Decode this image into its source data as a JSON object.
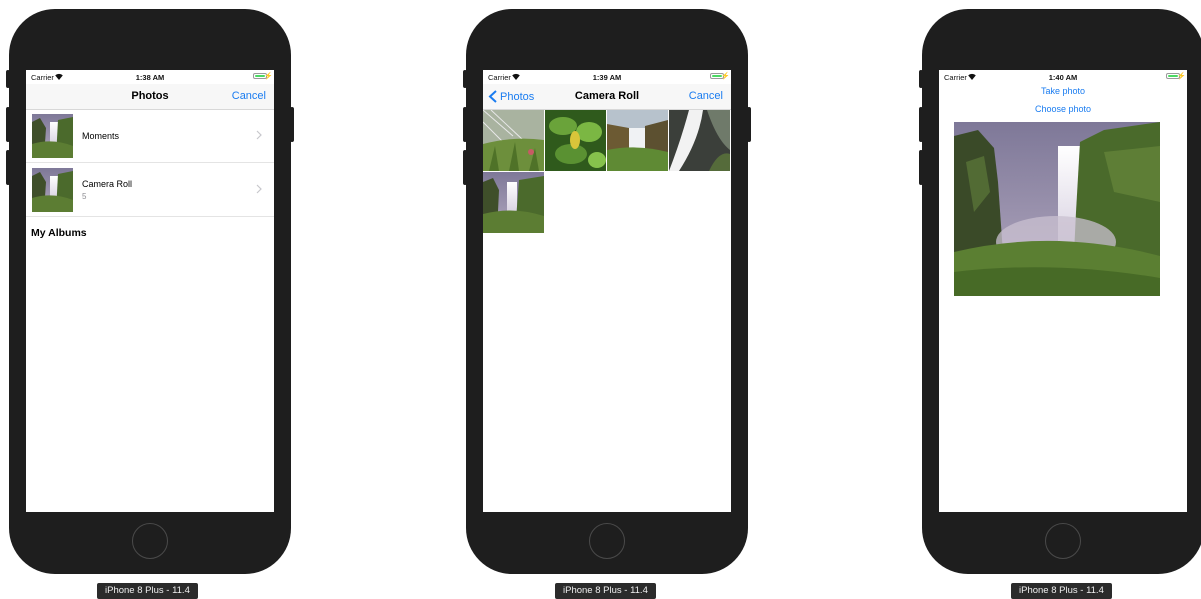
{
  "device_label": "iPhone 8 Plus - 11.4",
  "status": {
    "carrier": "Carrier",
    "times": [
      "1:38 AM",
      "1:39 AM",
      "1:40 AM"
    ]
  },
  "screen1": {
    "nav_title": "Photos",
    "cancel_label": "Cancel",
    "albums": [
      {
        "title": "Moments",
        "count": ""
      },
      {
        "title": "Camera Roll",
        "count": "5"
      }
    ],
    "section_header": "My Albums"
  },
  "screen2": {
    "back_label": "Photos",
    "nav_title": "Camera Roll",
    "cancel_label": "Cancel",
    "photos": [
      "waterfall-bw-photo",
      "plant-photo",
      "waterfall-canyon-photo",
      "waterfall-stream-photo",
      "waterfall-photo"
    ]
  },
  "screen3": {
    "take_photo_label": "Take photo",
    "choose_photo_label": "Choose photo",
    "image": "waterfall-photo"
  },
  "icons": {
    "status": [
      "wifi-icon",
      "battery-icon"
    ],
    "nav": [
      "chevron-left-icon",
      "chevron-right-icon"
    ]
  },
  "colors": {
    "tint": "#1a7cf0",
    "device": "#1e1e1e",
    "nav_bar": "#f7f7f7",
    "battery": "#4cd964"
  }
}
